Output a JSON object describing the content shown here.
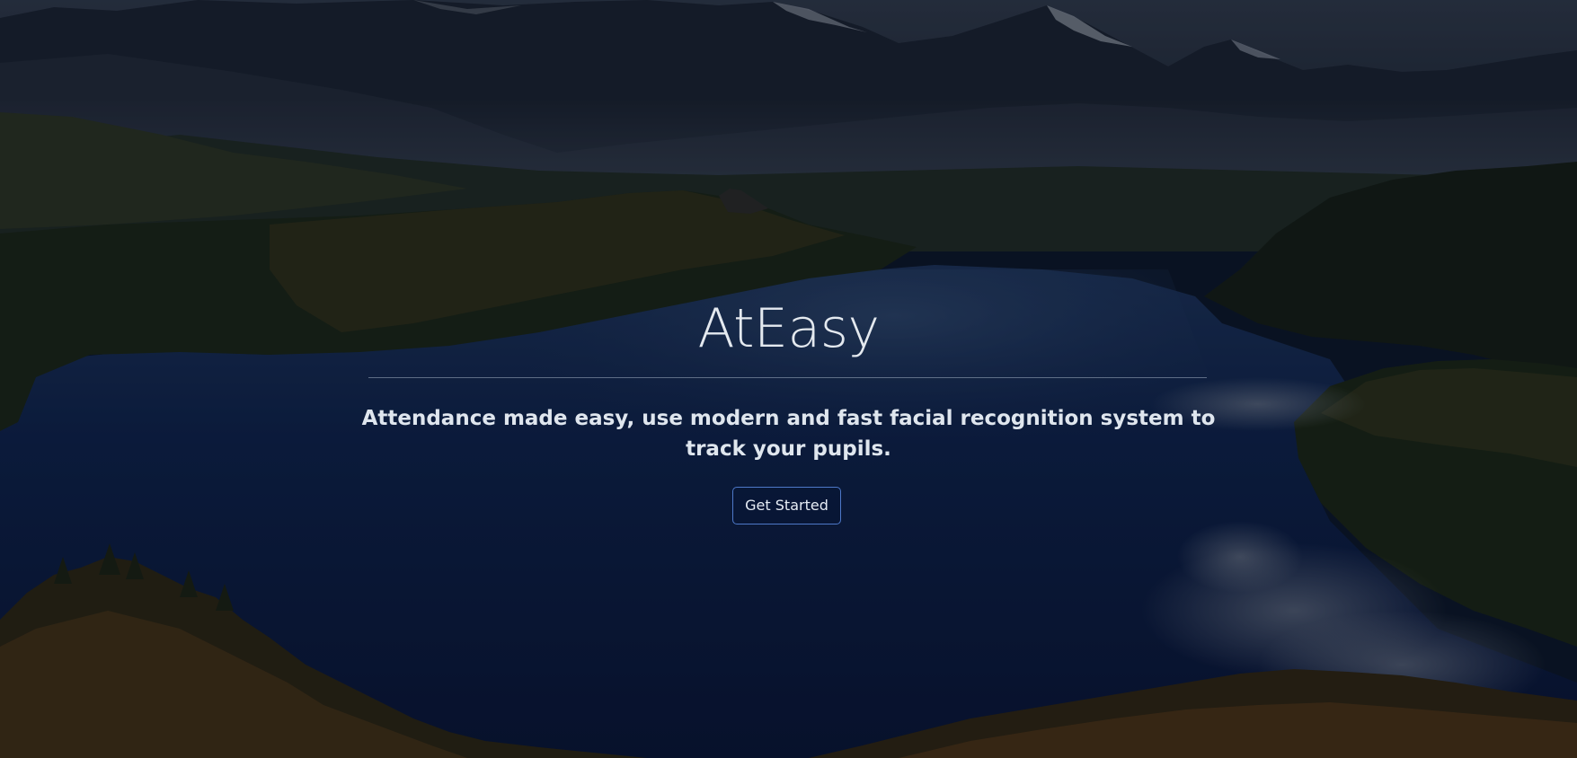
{
  "hero": {
    "title": "AtEasy",
    "tagline": "Attendance made easy, use modern and fast facial recognition system to track your pupils.",
    "cta_label": "Get Started"
  },
  "colors": {
    "sky": "#2a3442",
    "mountains": "#1c2431",
    "lake": "#0c1f45",
    "forest": "#1e2a16",
    "autumn_foliage": "#6b4a1c",
    "button_border": "#4d78c8",
    "text": "#e4e9ef"
  }
}
